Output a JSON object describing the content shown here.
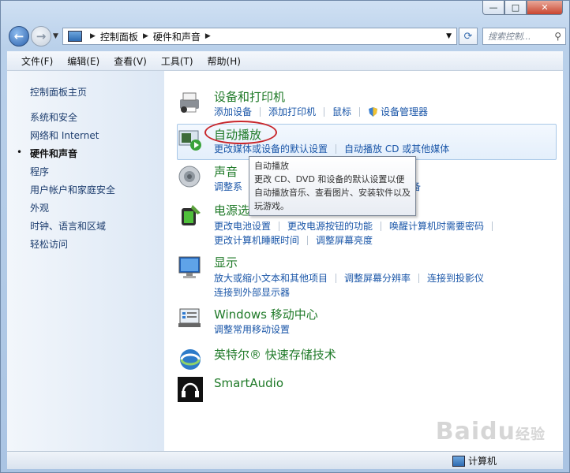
{
  "window": {
    "caption": {
      "minimize": "—",
      "maximize": "□",
      "close": "✕"
    }
  },
  "nav": {
    "breadcrumb": [
      "控制面板",
      "硬件和声音"
    ],
    "search_placeholder": "搜索控制..."
  },
  "menu": [
    "文件(F)",
    "编辑(E)",
    "查看(V)",
    "工具(T)",
    "帮助(H)"
  ],
  "sidebar": {
    "items": [
      {
        "label": "控制面板主页",
        "current": false
      },
      {
        "label": "系统和安全",
        "current": false
      },
      {
        "label": "网络和 Internet",
        "current": false
      },
      {
        "label": "硬件和声音",
        "current": true
      },
      {
        "label": "程序",
        "current": false
      },
      {
        "label": "用户帐户和家庭安全",
        "current": false
      },
      {
        "label": "外观",
        "current": false
      },
      {
        "label": "时钟、语言和区域",
        "current": false
      },
      {
        "label": "轻松访问",
        "current": false
      }
    ]
  },
  "categories": {
    "devices": {
      "title": "设备和打印机",
      "links": [
        "添加设备",
        "添加打印机",
        "鼠标",
        "设备管理器"
      ]
    },
    "autoplay": {
      "title": "自动播放",
      "links": [
        "更改媒体或设备的默认设置",
        "自动播放 CD 或其他媒体"
      ]
    },
    "sound": {
      "title": "声音",
      "line1_left": "调整系",
      "line1_right": "备"
    },
    "power": {
      "title": "电源选项",
      "row1": [
        "更改电池设置",
        "更改电源按钮的功能",
        "唤醒计算机时需要密码"
      ],
      "row2": [
        "更改计算机睡眠时间",
        "调整屏幕亮度"
      ]
    },
    "display": {
      "title": "显示",
      "row1": [
        "放大或缩小文本和其他项目",
        "调整屏幕分辨率",
        "连接到投影仪"
      ],
      "row2": [
        "连接到外部显示器"
      ]
    },
    "mobility": {
      "title": "Windows 移动中心",
      "links": [
        "调整常用移动设置"
      ]
    },
    "intel": {
      "title": "英特尔® 快速存储技术"
    },
    "smartaudio": {
      "title": "SmartAudio"
    }
  },
  "tooltip": {
    "title": "自动播放",
    "body": "更改 CD、DVD 和设备的默认设置以便自动播放音乐、查看图片、安装软件以及玩游戏。"
  },
  "status": {
    "computer": "计算机"
  },
  "watermark": {
    "brand": "Bai",
    "suffix": "du",
    "tail": "经验"
  },
  "colors": {
    "title_green": "#1f7a28",
    "link_blue": "#1a56a8",
    "annotation_red": "#c8262b"
  }
}
